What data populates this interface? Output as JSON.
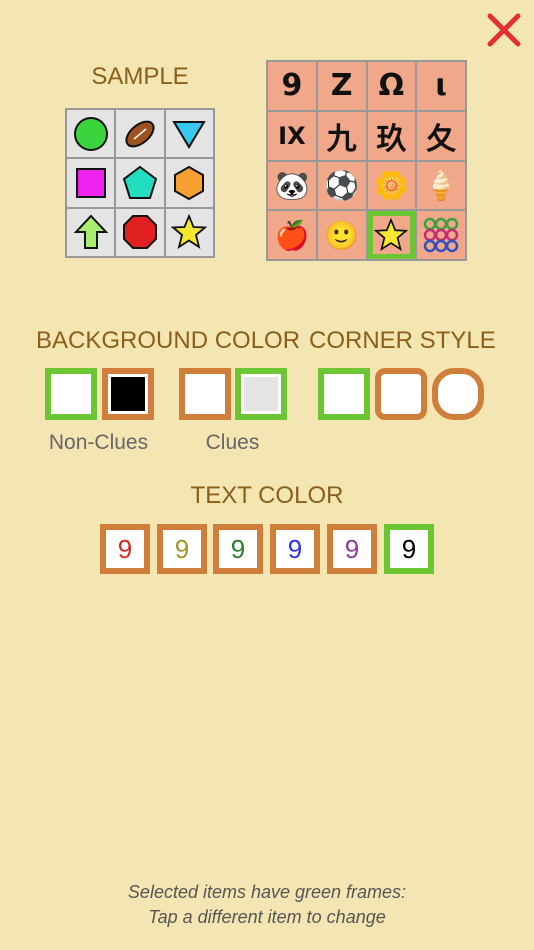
{
  "close_button": {
    "icon": "close-icon",
    "color": "#e03030"
  },
  "sample": {
    "heading": "SAMPLE",
    "cells": [
      "green-circle",
      "brown-football",
      "blue-triangle",
      "magenta-square",
      "teal-pentagon",
      "orange-hexagon",
      "green-up-arrow",
      "red-octagon",
      "yellow-star"
    ]
  },
  "symbol_set": {
    "cells": [
      {
        "text": "9"
      },
      {
        "text": "Z"
      },
      {
        "text": "Ω"
      },
      {
        "text": "ι"
      },
      {
        "text": "IX"
      },
      {
        "text": "九"
      },
      {
        "text": "玖"
      },
      {
        "text": "夂"
      },
      {
        "text": "🐼"
      },
      {
        "text": "⚽"
      },
      {
        "text": "🌼"
      },
      {
        "text": "🍦"
      },
      {
        "text": "🍎"
      },
      {
        "text": "🙂"
      },
      {
        "text": "★"
      },
      {
        "text": "⦾⦾⦾"
      }
    ],
    "selected_index": 14
  },
  "background_color": {
    "heading": "BACKGROUND COLOR",
    "non_clues_label": "Non-Clues",
    "clues_label": "Clues",
    "non_clues_options": [
      {
        "fill": "#ffffff",
        "selected": true
      },
      {
        "fill": "#000000",
        "selected": false
      }
    ],
    "clues_options": [
      {
        "fill": "#ffffff",
        "selected": false
      },
      {
        "fill": "#e4e4e4",
        "selected": true
      }
    ]
  },
  "corner_style": {
    "heading": "CORNER STYLE",
    "options": [
      {
        "style": "square",
        "selected": true
      },
      {
        "style": "rounded",
        "selected": false
      },
      {
        "style": "round",
        "selected": false
      }
    ]
  },
  "text_color": {
    "heading": "TEXT COLOR",
    "options": [
      {
        "glyph": "9",
        "color": "#d32b1f",
        "selected": false
      },
      {
        "glyph": "9",
        "color": "#a8912a",
        "selected": false
      },
      {
        "glyph": "9",
        "color": "#2e7d32",
        "selected": false
      },
      {
        "glyph": "9",
        "color": "#2f2ff0",
        "selected": false
      },
      {
        "glyph": "9",
        "color": "#8c3a9c",
        "selected": false
      },
      {
        "glyph": "9",
        "color": "#000000",
        "selected": true
      }
    ]
  },
  "footer": {
    "line1": "Selected items have green frames:",
    "line2": "Tap a different item to change"
  },
  "colors": {
    "background": "#f4e6b3",
    "heading": "#8b5e1a",
    "selected_frame": "#6cc634",
    "unselected_frame": "#cf7f3a",
    "tile": "#f0a78a"
  }
}
